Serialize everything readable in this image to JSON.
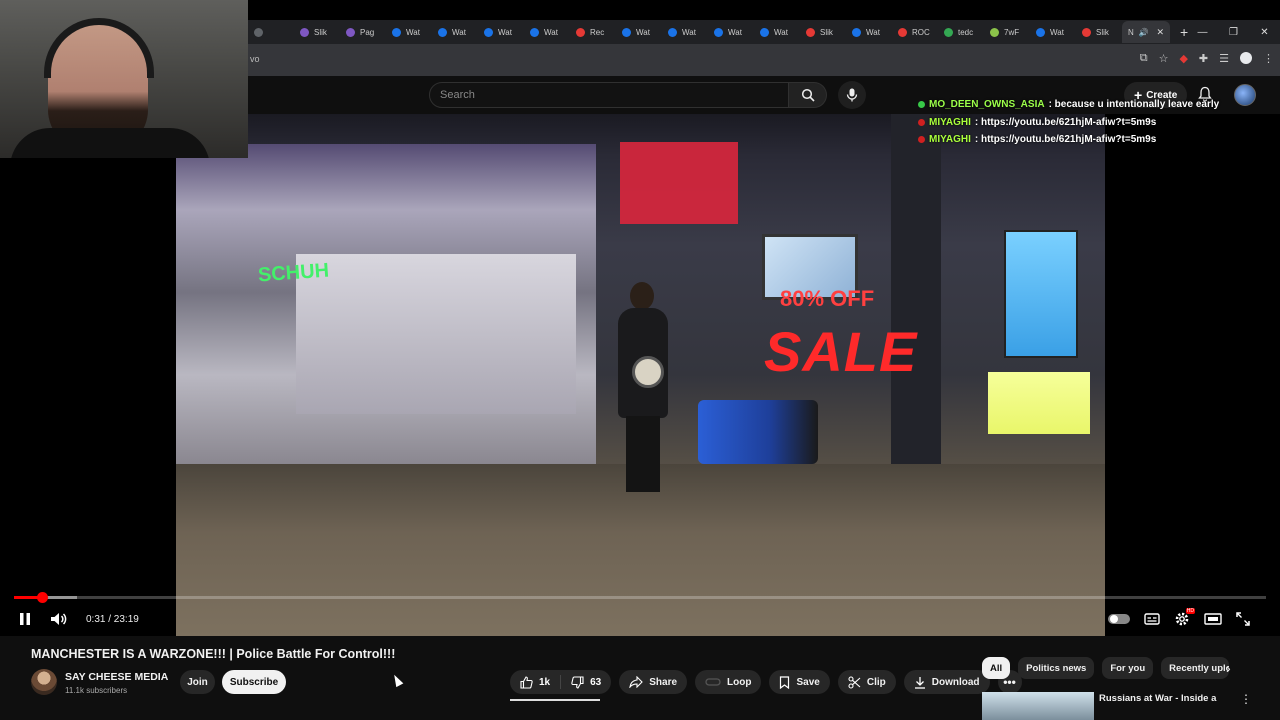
{
  "browser": {
    "tabs": [
      {
        "label": "",
        "color": "#5f6368"
      },
      {
        "label": "Slik",
        "color": "#7e57c2"
      },
      {
        "label": "Pag",
        "color": "#7e57c2"
      },
      {
        "label": "Wat",
        "color": "#1a73e8"
      },
      {
        "label": "Wat",
        "color": "#1a73e8"
      },
      {
        "label": "Wat",
        "color": "#1a73e8"
      },
      {
        "label": "Wat",
        "color": "#1a73e8"
      },
      {
        "label": "Rec",
        "color": "#e53935"
      },
      {
        "label": "Wat",
        "color": "#1a73e8"
      },
      {
        "label": "Wat",
        "color": "#1a73e8"
      },
      {
        "label": "Wat",
        "color": "#1a73e8"
      },
      {
        "label": "Wat",
        "color": "#1a73e8"
      },
      {
        "label": "Slik",
        "color": "#e53935"
      },
      {
        "label": "Wat",
        "color": "#1a73e8"
      },
      {
        "label": "ROC",
        "color": "#e53935"
      },
      {
        "label": "tedc",
        "color": "#34a853"
      },
      {
        "label": "7wF",
        "color": "#8bc34a"
      },
      {
        "label": "Wat",
        "color": "#1a73e8"
      },
      {
        "label": "Slik",
        "color": "#e53935"
      }
    ],
    "active_tab": {
      "label": "N",
      "audio_icon": "speaker-icon"
    },
    "address_text": "vo"
  },
  "youtube": {
    "search_placeholder": "Search",
    "create_label": "Create"
  },
  "chat": [
    {
      "user": "MO_DEEN_OWNS_ASIA",
      "message": ": because u intentionally leave early",
      "dot_color": "#38c948"
    },
    {
      "user": "MIYAGHI",
      "message": ": https://youtu.be/621hjM-afiw?t=5m9s",
      "dot_color": "#d02020"
    },
    {
      "user": "MIYAGHI",
      "message": ": https://youtu.be/621hjM-afiw?t=5m9s",
      "dot_color": "#d02020"
    }
  ],
  "video_scene": {
    "sign_text": "SCHUH",
    "sale_text": "SALE",
    "sale_prefix": "80% OFF"
  },
  "player": {
    "current_time": "0:31",
    "duration": "23:19",
    "time_display": "0:31 / 23:19",
    "progress_fraction": 0.022,
    "buffered_fraction": 0.05
  },
  "video": {
    "title": "MANCHESTER IS A WARZONE!!! | Police Battle For Control!!!",
    "channel_name": "SAY CHEESE MEDIA",
    "subscribers": "11.1k subscribers",
    "join_label": "Join",
    "subscribe_label": "Subscribe",
    "likes": "1k",
    "dislikes": "63",
    "share_label": "Share",
    "loop_label": "Loop",
    "save_label": "Save",
    "clip_label": "Clip",
    "download_label": "Download"
  },
  "recommendations": {
    "chips": [
      "All",
      "Politics news",
      "For you",
      "Recently uploa"
    ],
    "first_title": "Russians at War - Inside a"
  }
}
